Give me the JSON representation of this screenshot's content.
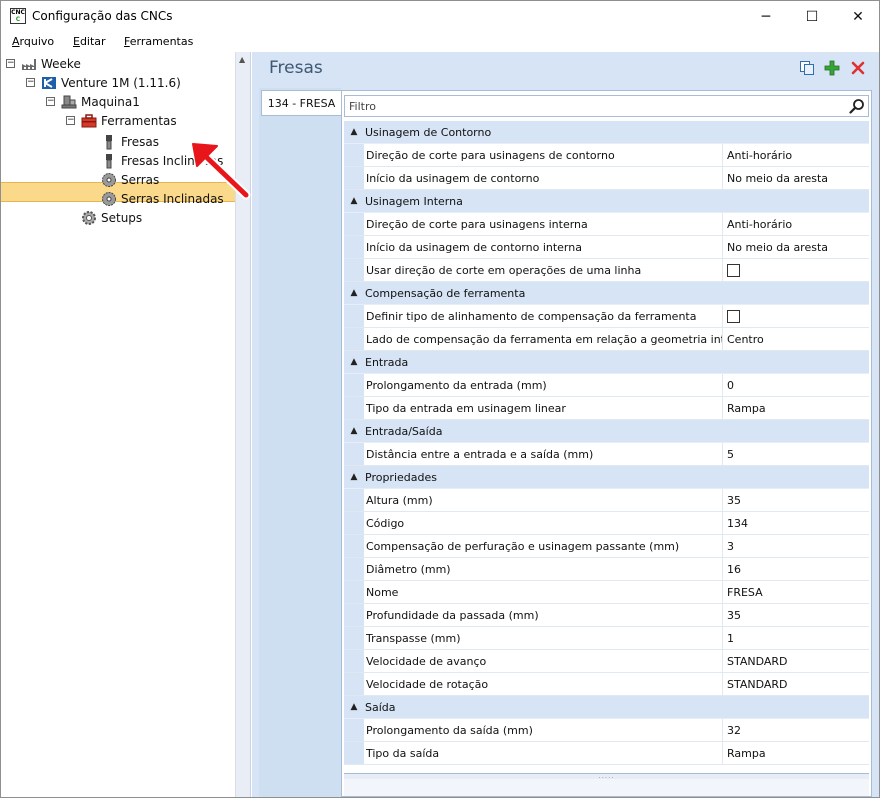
{
  "window": {
    "title": "Configuração das CNCs",
    "icon_text_top": "CNC",
    "icon_text_bottom": "C",
    "controls": {
      "minimize": "─",
      "maximize": "☐",
      "close": "✕"
    }
  },
  "menu": {
    "items": [
      {
        "label": "Arquivo",
        "underline": "A",
        "rest": "rquivo"
      },
      {
        "label": "Editar",
        "underline": "E",
        "rest": "ditar"
      },
      {
        "label": "Ferramentas",
        "underline": "F",
        "rest": "erramentas"
      }
    ]
  },
  "tree": {
    "nodes": [
      {
        "label": "Weeke",
        "icon": "factory-icon",
        "expander": "⊟"
      },
      {
        "label": "Venture 1M (1.11.6)",
        "icon": "cnc-machine-icon",
        "expander": "⊟"
      },
      {
        "label": "Maquina1",
        "icon": "machine-icon",
        "expander": "⊟"
      },
      {
        "label": "Ferramentas",
        "icon": "toolbox-icon",
        "expander": "⊟"
      },
      {
        "label": "Fresas",
        "icon": "mill-bit-icon"
      },
      {
        "label": "Fresas Inclinadas",
        "icon": "mill-bit-icon"
      },
      {
        "label": "Serras",
        "icon": "saw-blade-icon"
      },
      {
        "label": "Serras Inclinadas",
        "icon": "saw-blade-icon"
      },
      {
        "label": "Setups",
        "icon": "gear-icon"
      }
    ],
    "selected": "Fresas"
  },
  "panel": {
    "title": "Fresas",
    "tab_label": "134 - FRESA",
    "filter_placeholder": "Filtro",
    "colors": {
      "accent": "#d6e4f5",
      "selection": "#fbd98a",
      "add": "#3aa43a",
      "delete": "#e03030",
      "arrow": "#e8151b"
    }
  },
  "grid": {
    "sections": [
      {
        "name": "Usinagem de Contorno",
        "props": [
          {
            "name": "Direção de corte para usinagens de contorno",
            "value": "Anti-horário"
          },
          {
            "name": "Início da usinagem de contorno",
            "value": "No meio da aresta"
          }
        ]
      },
      {
        "name": "Usinagem Interna",
        "props": [
          {
            "name": "Direção de corte para usinagens interna",
            "value": "Anti-horário"
          },
          {
            "name": "Início da usinagem de contorno interna",
            "value": "No meio da aresta"
          },
          {
            "name": "Usar direção de corte em operações de uma linha",
            "value": "",
            "checkbox": true
          }
        ]
      },
      {
        "name": "Compensação de ferramenta",
        "props": [
          {
            "name": "Definir tipo de alinhamento de compensação da ferramenta",
            "value": "",
            "checkbox": true
          },
          {
            "name": "Lado de compensação da ferramenta em relação a geometria interna",
            "value": "Centro"
          }
        ]
      },
      {
        "name": "Entrada",
        "props": [
          {
            "name": "Prolongamento da entrada (mm)",
            "value": "0"
          },
          {
            "name": "Tipo da entrada em usinagem linear",
            "value": "Rampa"
          }
        ]
      },
      {
        "name": "Entrada/Saída",
        "props": [
          {
            "name": "Distância entre a entrada e a saída (mm)",
            "value": "5"
          }
        ]
      },
      {
        "name": "Propriedades",
        "props": [
          {
            "name": "Altura (mm)",
            "value": "35"
          },
          {
            "name": "Código",
            "value": "134"
          },
          {
            "name": "Compensação de perfuração e usinagem passante (mm)",
            "value": "3"
          },
          {
            "name": "Diâmetro (mm)",
            "value": "16"
          },
          {
            "name": "Nome",
            "value": "FRESA"
          },
          {
            "name": "Profundidade da passada (mm)",
            "value": "35"
          },
          {
            "name": "Transpasse (mm)",
            "value": "1"
          },
          {
            "name": "Velocidade de avanço",
            "value": "STANDARD"
          },
          {
            "name": "Velocidade de rotação",
            "value": "STANDARD"
          }
        ]
      },
      {
        "name": "Saída",
        "props": [
          {
            "name": "Prolongamento da saída (mm)",
            "value": "32"
          },
          {
            "name": "Tipo da saída",
            "value": "Rampa"
          }
        ]
      }
    ]
  }
}
